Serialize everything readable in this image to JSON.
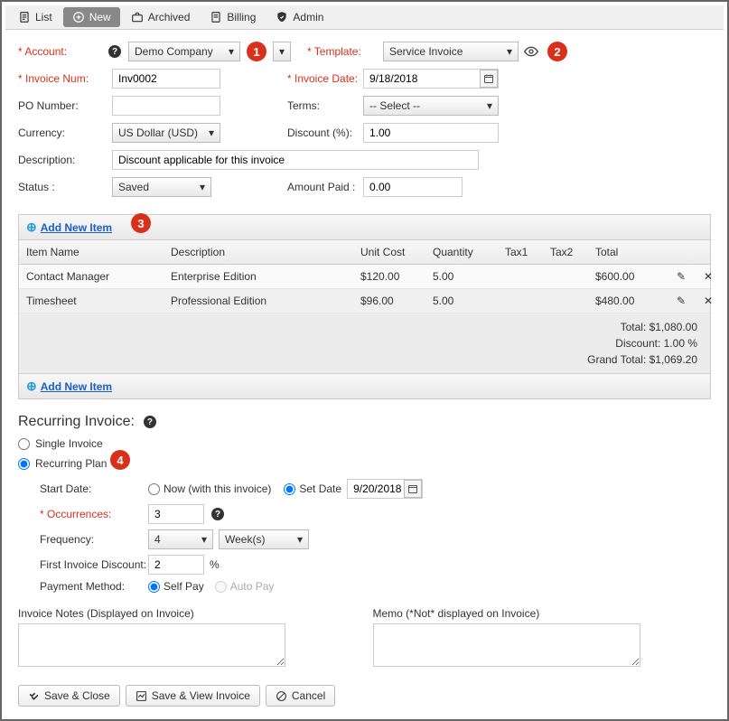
{
  "tabs": {
    "list": "List",
    "new": "New",
    "archived": "Archived",
    "billing": "Billing",
    "admin": "Admin"
  },
  "form": {
    "account_label": "* Account:",
    "account_value": "Demo Company",
    "template_label": "* Template:",
    "template_value": "Service Invoice",
    "invoice_num_label": "* Invoice Num:",
    "invoice_num_value": "Inv0002",
    "invoice_date_label": "* Invoice Date:",
    "invoice_date_value": "9/18/2018",
    "po_label": "PO Number:",
    "po_value": "",
    "terms_label": "Terms:",
    "terms_value": "-- Select --",
    "currency_label": "Currency:",
    "currency_value": "US Dollar (USD)",
    "discount_label": "Discount (%):",
    "discount_value": "1.00",
    "description_label": "Description:",
    "description_value": "Discount applicable for this invoice",
    "status_label": "Status :",
    "status_value": "Saved",
    "amount_paid_label": "Amount Paid :",
    "amount_paid_value": "0.00"
  },
  "callouts": {
    "c1": "1",
    "c2": "2",
    "c3": "3",
    "c4": "4"
  },
  "items": {
    "add_new": "Add New Item",
    "headers": {
      "name": "Item Name",
      "desc": "Description",
      "unit": "Unit Cost",
      "qty": "Quantity",
      "tax1": "Tax1",
      "tax2": "Tax2",
      "total": "Total"
    },
    "rows": [
      {
        "name": "Contact Manager",
        "desc": "Enterprise Edition",
        "unit": "$120.00",
        "qty": "5.00",
        "total": "$600.00"
      },
      {
        "name": "Timesheet",
        "desc": "Professional Edition",
        "unit": "$96.00",
        "qty": "5.00",
        "total": "$480.00"
      }
    ],
    "totals": {
      "total": "Total: $1,080.00",
      "discount": "Discount: 1.00 %",
      "grand": "Grand Total: $1,069.20"
    }
  },
  "recurring": {
    "title": "Recurring Invoice:",
    "single": "Single Invoice",
    "plan": "Recurring Plan",
    "start_date_label": "Start Date:",
    "now_label": "Now (with this invoice)",
    "set_date_label": "Set Date",
    "set_date_value": "9/20/2018",
    "occurrences_label": "* Occurrences:",
    "occurrences_value": "3",
    "frequency_label": "Frequency:",
    "frequency_value": "4",
    "frequency_unit": "Week(s)",
    "first_discount_label": "First Invoice Discount:",
    "first_discount_value": "2",
    "percent": "%",
    "payment_method_label": "Payment Method:",
    "self_pay": "Self Pay",
    "auto_pay": "Auto Pay"
  },
  "notes": {
    "invoice_notes_label": "Invoice Notes (Displayed on Invoice)",
    "memo_label": "Memo (*Not* displayed on Invoice)"
  },
  "buttons": {
    "save_close": "Save & Close",
    "save_view": "Save & View Invoice",
    "cancel": "Cancel"
  }
}
